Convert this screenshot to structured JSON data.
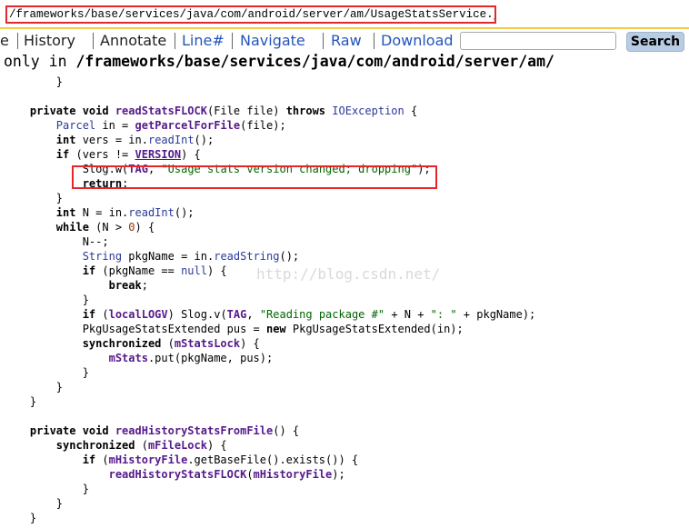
{
  "path_bar": {
    "text": "/frameworks/base/services/java/com/android/server/am/UsageStatsService.java"
  },
  "menu": {
    "items": [
      {
        "label": "e",
        "style": "plain"
      },
      {
        "label": "History",
        "style": "plain"
      },
      {
        "label": "Annotate",
        "style": "plain"
      },
      {
        "label": "Line#",
        "style": "link"
      },
      {
        "label": "Navigate",
        "style": "link"
      },
      {
        "label": "Raw",
        "style": "link"
      },
      {
        "label": "Download",
        "style": "link"
      }
    ],
    "search_value": "",
    "search_button": "Search"
  },
  "directory_line": {
    "prefix": "only in ",
    "path": "/frameworks/base/services/java/com/android/server/am/"
  },
  "watermark": "http://blog.csdn.net/",
  "code_lines": [
    [
      "        ",
      "}",
      "",
      "",
      "",
      "",
      ""
    ],
    [],
    [
      "    ",
      "private void ",
      "readStatsFLOCK",
      "(File file) ",
      "throws ",
      "IOException",
      " {"
    ],
    [
      "        ",
      "Parcel",
      " in = ",
      "getParcelForFile",
      "(file);",
      "",
      ""
    ],
    [
      "        ",
      "int",
      " vers = in.",
      "readInt",
      "();",
      "",
      ""
    ],
    [
      "        ",
      "if",
      " (vers != ",
      "VERSION",
      ") {",
      "",
      ""
    ],
    [
      "            Slog.w(",
      "TAG",
      ", ",
      "\"Usage stats version changed; dropping\"",
      ");",
      "",
      ""
    ],
    [
      "            ",
      "return",
      ";",
      "",
      "",
      "",
      ""
    ],
    [
      "        }",
      "",
      "",
      "",
      "",
      "",
      ""
    ],
    [
      "        ",
      "int",
      " N = in.",
      "readInt",
      "();",
      "",
      ""
    ],
    [
      "        ",
      "while",
      " (N > ",
      "0",
      ") {",
      "",
      ""
    ],
    [
      "            N--;",
      "",
      "",
      "",
      "",
      "",
      ""
    ],
    [
      "            ",
      "String",
      " pkgName = in.",
      "readString",
      "();",
      "",
      ""
    ],
    [
      "            ",
      "if",
      " (pkgName == ",
      "null",
      ") {",
      "",
      ""
    ],
    [
      "                ",
      "break",
      ";",
      "",
      "",
      "",
      ""
    ],
    [
      "            }",
      "",
      "",
      "",
      "",
      "",
      ""
    ],
    [
      "            ",
      "if",
      " (",
      "localLOGV",
      ") Slog.v(",
      "TAG",
      ", "
    ],
    [
      "            PkgUsageStatsExtended pus = ",
      "new",
      " PkgUsageStatsExtended(in);",
      "",
      "",
      "",
      ""
    ],
    [
      "            ",
      "synchronized",
      " (",
      "mStatsLock",
      ") {",
      "",
      ""
    ],
    [
      "                ",
      "mStats",
      ".put(pkgName, pus);",
      "",
      "",
      "",
      ""
    ],
    [
      "            }",
      "",
      "",
      "",
      "",
      "",
      ""
    ],
    [
      "        }",
      "",
      "",
      "",
      "",
      "",
      ""
    ],
    [
      "    }",
      "",
      "",
      "",
      "",
      "",
      ""
    ],
    [],
    [
      "    ",
      "private void ",
      "readHistoryStatsFromFile",
      "() {",
      "",
      "",
      ""
    ],
    [
      "        ",
      "synchronized",
      " (",
      "mFileLock",
      ") {",
      "",
      ""
    ],
    [
      "            ",
      "if",
      " (",
      "mHistoryFile",
      ".getBaseFile().exists()) {",
      "",
      ""
    ],
    [
      "                ",
      "readHistoryStatsFLOCK",
      "(",
      "mHistoryFile",
      ");",
      "",
      ""
    ],
    [
      "            }",
      "",
      "",
      "",
      "",
      "",
      ""
    ],
    [
      "        }",
      "",
      "",
      "",
      "",
      "",
      ""
    ],
    [
      "    }",
      "",
      "",
      "",
      "",
      "",
      ""
    ]
  ],
  "code_line_extra_16": [
    "\"Reading package #\"",
    " + N + ",
    "\": \"",
    " + pkgName);"
  ]
}
